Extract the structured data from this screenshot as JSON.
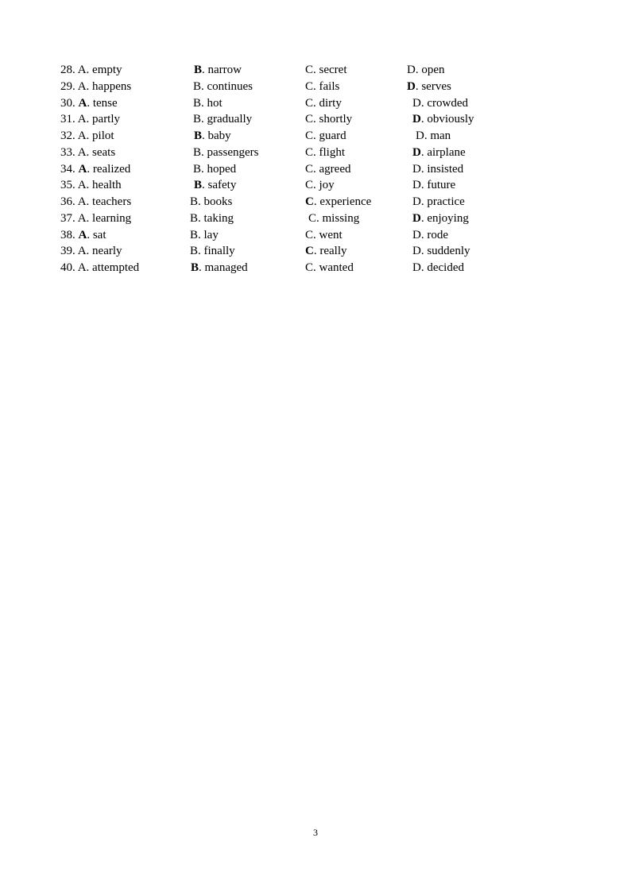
{
  "questions": [
    {
      "number": "28.",
      "options": [
        {
          "letter": "A",
          "text": "empty",
          "bold": false
        },
        {
          "letter": "B",
          "text": "narrow",
          "bold": true
        },
        {
          "letter": "C",
          "text": "secret",
          "bold": false
        },
        {
          "letter": "D",
          "text": "open",
          "bold": false
        }
      ]
    },
    {
      "number": "29.",
      "options": [
        {
          "letter": "A",
          "text": "happens",
          "bold": false
        },
        {
          "letter": "B",
          "text": "continues",
          "bold": false
        },
        {
          "letter": "C",
          "text": "fails",
          "bold": false
        },
        {
          "letter": "D",
          "text": "serves",
          "bold": true
        }
      ]
    },
    {
      "number": "30.",
      "options": [
        {
          "letter": "A",
          "text": "tense",
          "bold": true
        },
        {
          "letter": "B",
          "text": "hot",
          "bold": false
        },
        {
          "letter": "C",
          "text": "dirty",
          "bold": false
        },
        {
          "letter": "D",
          "text": "crowded",
          "bold": false
        }
      ]
    },
    {
      "number": "31.",
      "options": [
        {
          "letter": "A",
          "text": "partly",
          "bold": false
        },
        {
          "letter": "B",
          "text": "gradually",
          "bold": false
        },
        {
          "letter": "C",
          "text": "shortly",
          "bold": false
        },
        {
          "letter": "D",
          "text": "obviously",
          "bold": true
        }
      ]
    },
    {
      "number": "32.",
      "options": [
        {
          "letter": "A",
          "text": "pilot",
          "bold": false
        },
        {
          "letter": "B",
          "text": "baby",
          "bold": true
        },
        {
          "letter": "C",
          "text": "guard",
          "bold": false
        },
        {
          "letter": "D",
          "text": "man",
          "bold": false
        }
      ]
    },
    {
      "number": "33.",
      "options": [
        {
          "letter": "A",
          "text": "seats",
          "bold": false
        },
        {
          "letter": "B",
          "text": "passengers",
          "bold": false
        },
        {
          "letter": "C",
          "text": "flight",
          "bold": false
        },
        {
          "letter": "D",
          "text": "airplane",
          "bold": true
        }
      ]
    },
    {
      "number": "34.",
      "options": [
        {
          "letter": "A",
          "text": "realized",
          "bold": true
        },
        {
          "letter": "B",
          "text": "hoped",
          "bold": false
        },
        {
          "letter": "C",
          "text": "agreed",
          "bold": false
        },
        {
          "letter": "D",
          "text": "insisted",
          "bold": false
        }
      ]
    },
    {
      "number": "35.",
      "options": [
        {
          "letter": "A",
          "text": "health",
          "bold": false
        },
        {
          "letter": "B",
          "text": "safety",
          "bold": true
        },
        {
          "letter": "C",
          "text": "joy",
          "bold": false
        },
        {
          "letter": "D",
          "text": "future",
          "bold": false
        }
      ]
    },
    {
      "number": "36.",
      "options": [
        {
          "letter": "A",
          "text": "teachers",
          "bold": false
        },
        {
          "letter": "B",
          "text": "books",
          "bold": false
        },
        {
          "letter": "C",
          "text": "experience",
          "bold": true
        },
        {
          "letter": "D",
          "text": "practice",
          "bold": false
        }
      ]
    },
    {
      "number": "37.",
      "options": [
        {
          "letter": "A",
          "text": "learning",
          "bold": false
        },
        {
          "letter": "B",
          "text": "taking",
          "bold": false
        },
        {
          "letter": "C",
          "text": "missing",
          "bold": false
        },
        {
          "letter": "D",
          "text": "enjoying",
          "bold": true
        }
      ]
    },
    {
      "number": "38.",
      "options": [
        {
          "letter": "A",
          "text": "sat",
          "bold": true
        },
        {
          "letter": "B",
          "text": "lay",
          "bold": false
        },
        {
          "letter": "C",
          "text": "went",
          "bold": false
        },
        {
          "letter": "D",
          "text": "rode",
          "bold": false
        }
      ]
    },
    {
      "number": "39.",
      "options": [
        {
          "letter": "A",
          "text": "nearly",
          "bold": false
        },
        {
          "letter": "B",
          "text": "finally",
          "bold": false
        },
        {
          "letter": "C",
          "text": "really",
          "bold": true
        },
        {
          "letter": "D",
          "text": "suddenly",
          "bold": false
        }
      ]
    },
    {
      "number": "40.",
      "options": [
        {
          "letter": "A",
          "text": "attempted",
          "bold": false
        },
        {
          "letter": "B",
          "text": "managed",
          "bold": true
        },
        {
          "letter": "C",
          "text": "wanted",
          "bold": false
        },
        {
          "letter": "D",
          "text": "decided",
          "bold": false
        }
      ]
    }
  ],
  "separator": ". ",
  "page_number": "3"
}
